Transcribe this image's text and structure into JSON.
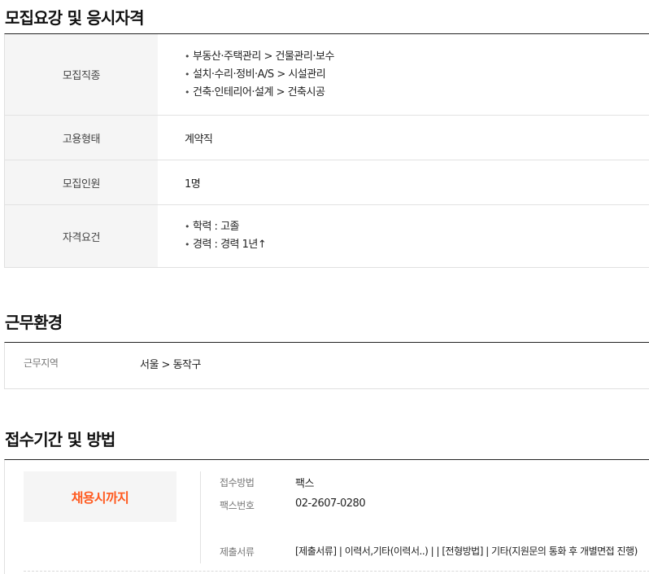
{
  "section1": {
    "title": "모집요강 및 응시자격",
    "rows": [
      {
        "label": "모집직종",
        "lines": [
          "부동산·주택관리 > 건물관리·보수",
          "설치·수리·정비·A/S > 시설관리",
          "건축·인테리어·설계 > 건축시공"
        ]
      },
      {
        "label": "고용형태",
        "value": "계약직"
      },
      {
        "label": "모집인원",
        "value": "1명"
      },
      {
        "label": "자격요건",
        "lines": [
          "학력 : 고졸",
          "경력 : 경력 1년↑"
        ]
      }
    ],
    "bullet": "•"
  },
  "section2": {
    "title": "근무환경",
    "work_area_label": "근무지역",
    "work_area_value": "서울 > 동작구"
  },
  "section3": {
    "title": "접수기간 및 방법",
    "deadline": "채용시까지",
    "method_label": "접수방법",
    "method_value": "팩스",
    "fax_label": "팩스번호",
    "fax_value": "02-2607-0280",
    "docs_label": "제출서류",
    "docs_value": "[제출서류] | 이력서,기타(이력서..) | | [전형방법] | 기타(지원문의 통화 후 개별면접 진행)"
  },
  "colors": {
    "accent": "#ff5a1f",
    "header_bg": "#f5f5f5",
    "border": "#e2e2e2"
  }
}
